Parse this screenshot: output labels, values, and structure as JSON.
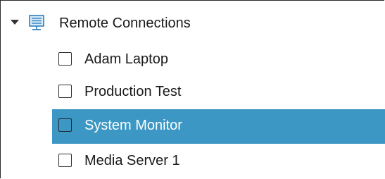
{
  "tree": {
    "root": {
      "label": "Remote Connections",
      "icon": "monitor-icon",
      "expanded": true
    },
    "items": [
      {
        "label": "Adam Laptop",
        "checked": false,
        "selected": false
      },
      {
        "label": "Production Test",
        "checked": false,
        "selected": false
      },
      {
        "label": "System Monitor",
        "checked": false,
        "selected": true
      },
      {
        "label": "Media Server 1",
        "checked": false,
        "selected": false
      }
    ]
  },
  "colors": {
    "selection": "#3c97c4",
    "icon_blue": "#2f7fc0",
    "text": "#1a1a1a"
  }
}
